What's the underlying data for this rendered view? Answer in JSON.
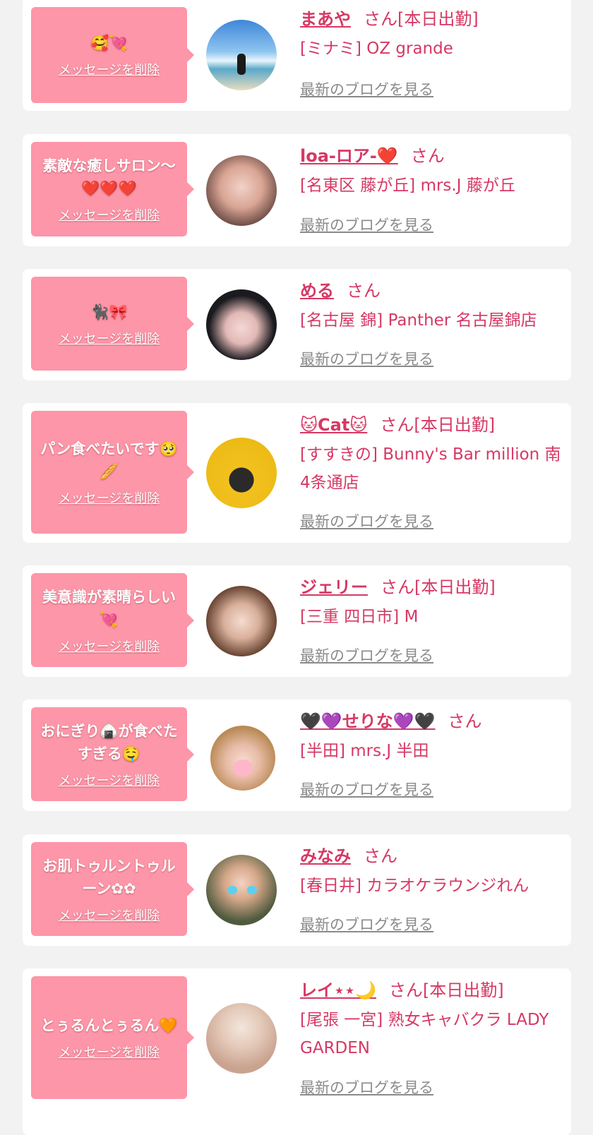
{
  "delete_label": "メッセージを削除",
  "blog_label": "最新のブログを見る",
  "san_label": "さん",
  "entries": [
    {
      "message": "🥰💘",
      "name": "まあや",
      "status": "[本日出勤]",
      "shop": "[ミナミ] OZ grande",
      "avatar_icon": "beach-photo"
    },
    {
      "message": "素敵な癒しサロン〜❤️❤️❤️",
      "name": "loa-ロア-❤️",
      "status": "",
      "shop": "[名東区 藤が丘] mrs.J 藤が丘",
      "avatar_icon": "woman-photo"
    },
    {
      "message": "🐈‍⬛🎀",
      "name": "める",
      "status": "",
      "shop": "[名古屋 錦] Panther 名古屋錦店",
      "avatar_icon": "woman-photo"
    },
    {
      "message": "パン食べたいです🥺🥖",
      "name": "🐱Cat🐱",
      "status": "[本日出勤]",
      "shop": "[すすきの] Bunny's Bar million 南4条通店",
      "avatar_icon": "magazine-photo"
    },
    {
      "message": "美意識が素晴らしい💘",
      "name": "ジェリー",
      "status": "[本日出勤]",
      "shop": "[三重 四日市] M",
      "avatar_icon": "woman-photo"
    },
    {
      "message": "おにぎり🍙が食べたすぎる🤤",
      "name": "🖤💜せりな💜🖤",
      "status": "",
      "shop": "[半田] mrs.J 半田",
      "avatar_icon": "woman-photo"
    },
    {
      "message": "お肌トゥルントゥルーン✿✿",
      "name": "みなみ",
      "status": "",
      "shop": "[春日井] カラオケラウンジれん",
      "avatar_icon": "woman-photo"
    },
    {
      "message": "とぅるんとぅるん🧡",
      "name": "レイ⋆⋆🌙",
      "status": "[本日出勤]",
      "shop": "[尾張 一宮] 熟女キャバクラ LADY GARDEN",
      "avatar_icon": "woman-photo"
    }
  ]
}
